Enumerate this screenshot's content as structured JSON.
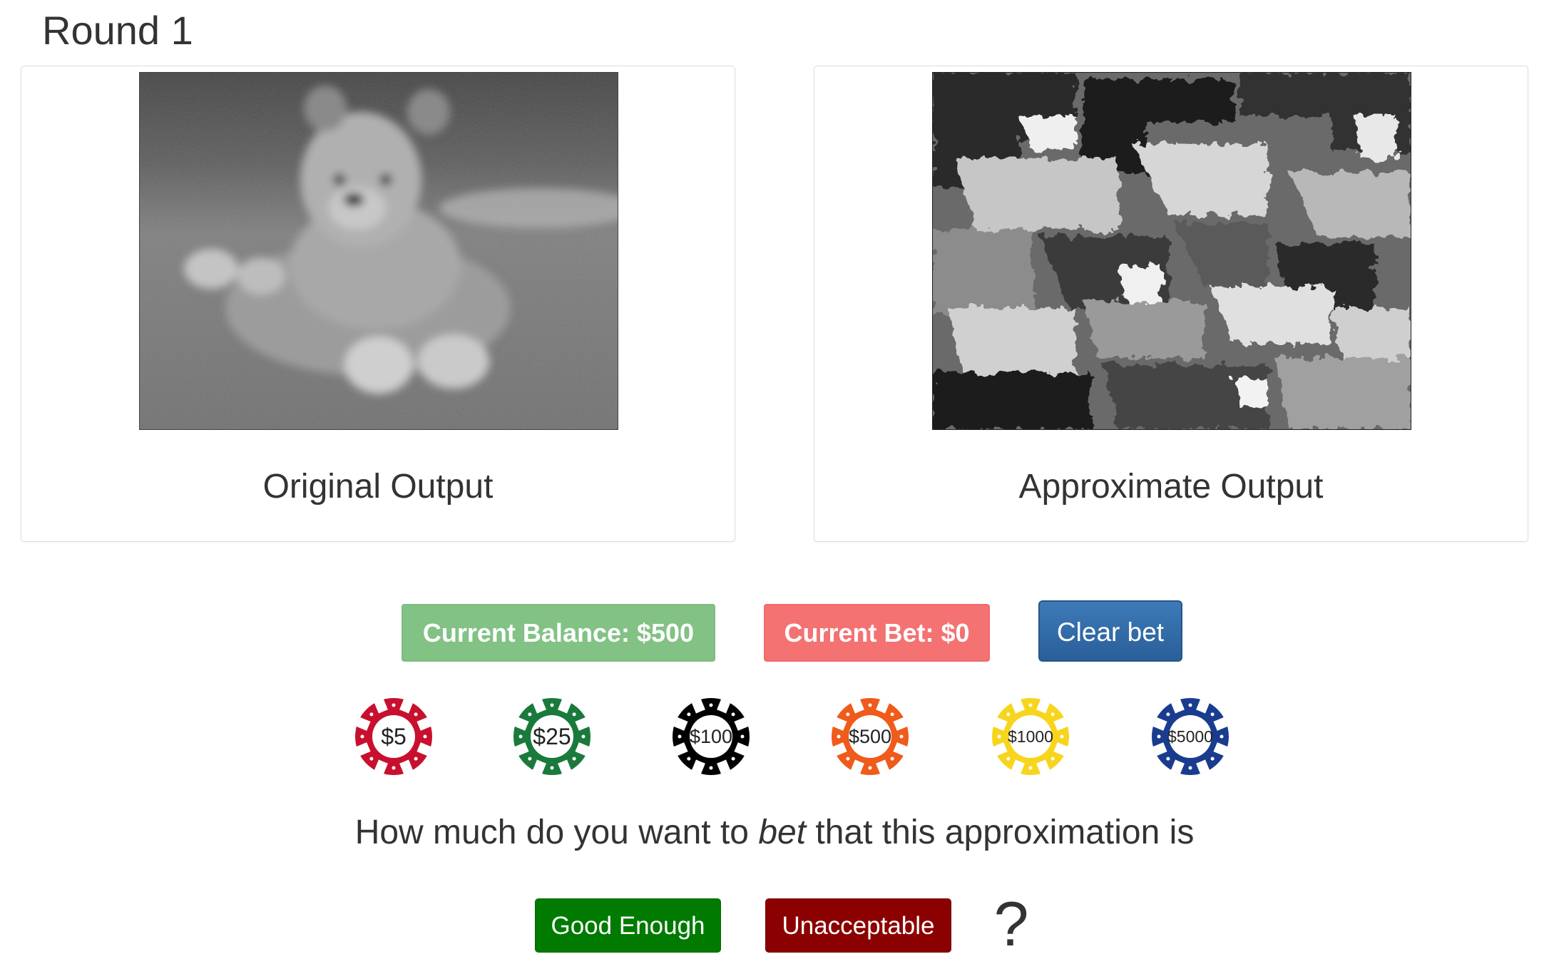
{
  "round": {
    "title": "Round 1"
  },
  "panels": {
    "original": {
      "caption": "Original Output"
    },
    "approximate": {
      "caption": "Approximate Output"
    }
  },
  "status": {
    "balance": "Current Balance: $500",
    "bet": "Current Bet: $0"
  },
  "actions": {
    "clear_bet": "Clear bet",
    "good_enough": "Good Enough",
    "unacceptable": "Unacceptable",
    "help": "?"
  },
  "chips": [
    {
      "label": "$5",
      "color": "#c8102e"
    },
    {
      "label": "$25",
      "color": "#1a7a3c"
    },
    {
      "label": "$100",
      "color": "#000000"
    },
    {
      "label": "$500",
      "color": "#f05a1a"
    },
    {
      "label": "$1000",
      "color": "#f7d51d"
    },
    {
      "label": "$5000",
      "color": "#1a3c8f"
    }
  ],
  "question": {
    "before": "How much do you want to ",
    "emphasis": "bet",
    "after": " that this approximation is"
  },
  "colors": {
    "balance_bg": "#82c285",
    "bet_bg": "#f47272",
    "clear_bg": "#2a5f99",
    "good_bg": "#007a00",
    "bad_bg": "#8b0000"
  }
}
